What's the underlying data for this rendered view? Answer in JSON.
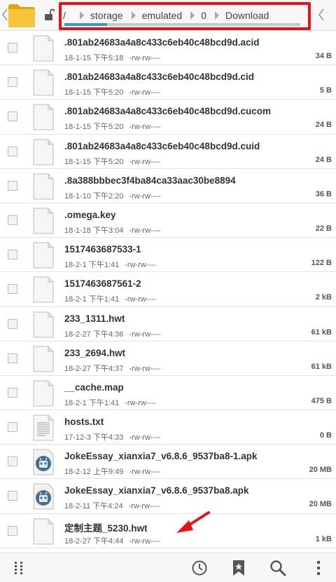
{
  "breadcrumb": {
    "items": [
      "/",
      "storage",
      "emulated",
      "0",
      "Download"
    ],
    "scroll_progress": 0.18
  },
  "files": [
    {
      "name": ".801ab24683a4a8c433c6eb40c48bcd9d.acid",
      "date": "18-1-15 下午5:18",
      "perm": "-rw-rw----",
      "size": "34 B",
      "icon": "document-icon"
    },
    {
      "name": ".801ab24683a4a8c433c6eb40c48bcd9d.cid",
      "date": "18-1-15 下午5:20",
      "perm": "-rw-rw----",
      "size": "5 B",
      "icon": "document-icon"
    },
    {
      "name": ".801ab24683a4a8c433c6eb40c48bcd9d.cucom",
      "date": "18-1-15 下午5:20",
      "perm": "-rw-rw----",
      "size": "24 B",
      "icon": "document-icon"
    },
    {
      "name": ".801ab24683a4a8c433c6eb40c48bcd9d.cuid",
      "date": "18-1-15 下午5:20",
      "perm": "-rw-rw----",
      "size": "24 B",
      "icon": "document-icon"
    },
    {
      "name": ".8a388bbbec3f4ba84ca33aac30be8894",
      "date": "18-1-10 下午2:20",
      "perm": "-rw-rw----",
      "size": "36 B",
      "icon": "document-icon"
    },
    {
      "name": ".omega.key",
      "date": "18-1-18 下午3:04",
      "perm": "-rw-rw----",
      "size": "22 B",
      "icon": "document-icon"
    },
    {
      "name": "1517463687533-1",
      "date": "18-2-1 下午1:41",
      "perm": "-rw-rw----",
      "size": "122 B",
      "icon": "document-icon"
    },
    {
      "name": "1517463687561-2",
      "date": "18-2-1 下午1:41",
      "perm": "-rw-rw----",
      "size": "2 kB",
      "icon": "document-icon"
    },
    {
      "name": "233_1311.hwt",
      "date": "18-2-27 下午4:36",
      "perm": "-rw-rw----",
      "size": "61 kB",
      "icon": "document-icon"
    },
    {
      "name": "233_2694.hwt",
      "date": "18-2-27 下午4:37",
      "perm": "-rw-rw----",
      "size": "61 kB",
      "icon": "document-icon"
    },
    {
      "name": "__cache.map",
      "date": "18-2-1 下午1:41",
      "perm": "-rw-rw----",
      "size": "475 B",
      "icon": "document-icon"
    },
    {
      "name": "hosts.txt",
      "date": "17-12-3 下午4:33",
      "perm": "-rw-rw----",
      "size": "0 B",
      "icon": "text-file-icon"
    },
    {
      "name": "JokeEssay_xianxia7_v6.8.6_9537ba8-1.apk",
      "date": "18-2-12 上午9:49",
      "perm": "-rw-rw----",
      "size": "20 MB",
      "icon": "android-apk-icon"
    },
    {
      "name": "JokeEssay_xianxia7_v6.8.6_9537ba8.apk",
      "date": "18-2-11 下午4:24",
      "perm": "-rw-rw----",
      "size": "20 MB",
      "icon": "android-apk-icon"
    },
    {
      "name": "定制主题_5230.hwt",
      "date": "18-2-27 下午4:44",
      "perm": "-rw-rw----",
      "size": "1 kB",
      "icon": "document-icon"
    }
  ],
  "colors": {
    "highlight": "#e8101b",
    "accent": "#2aa0d8",
    "folder": "#f4b400"
  },
  "bottom_bar": {
    "icons": [
      "drag-handle-icon",
      "history-icon",
      "bookmark-icon",
      "search-icon",
      "more-vert-icon"
    ]
  }
}
